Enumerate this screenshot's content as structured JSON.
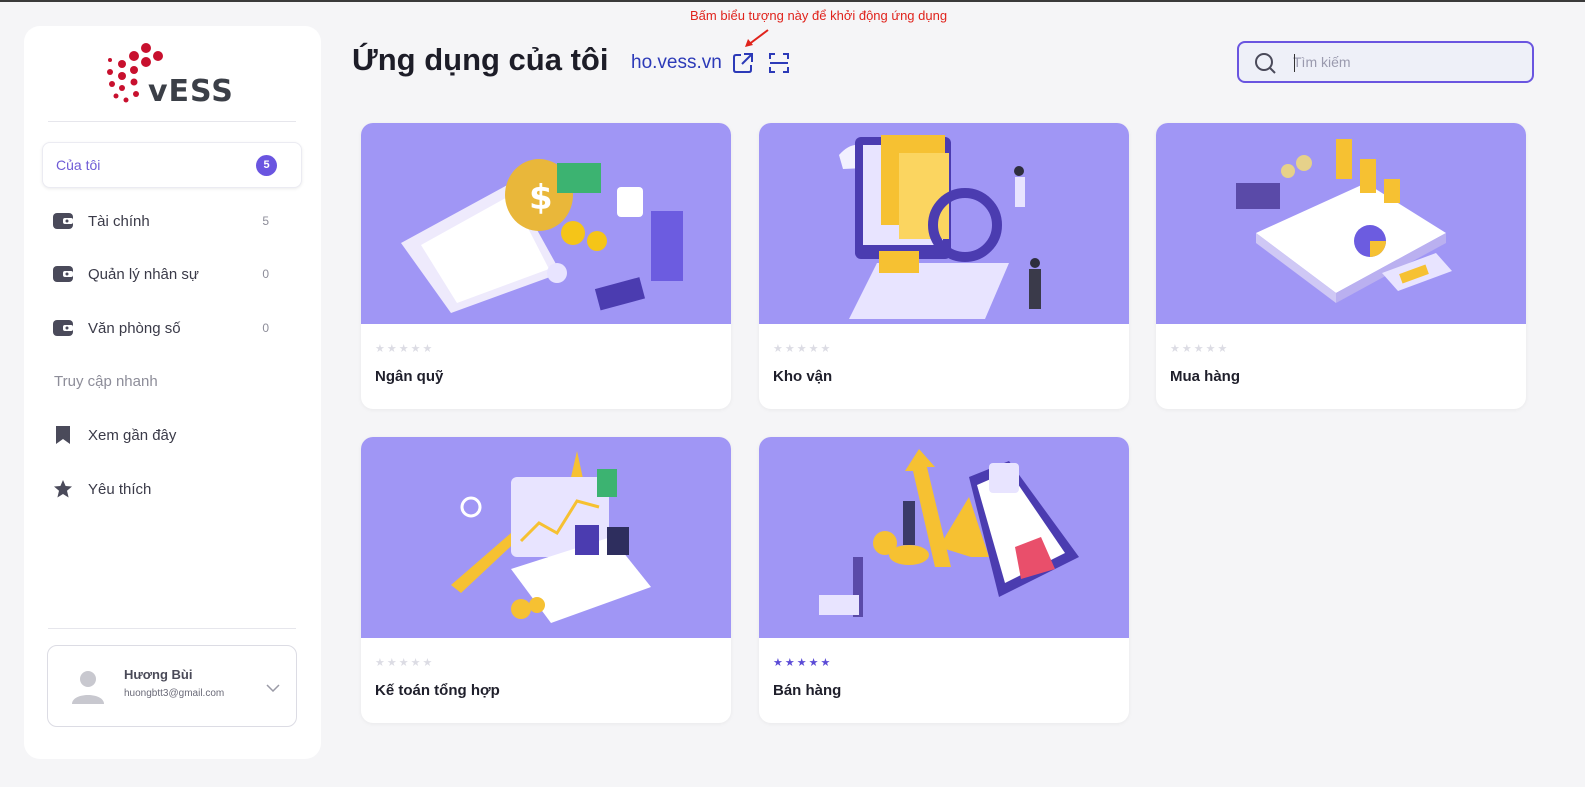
{
  "brand": {
    "logo_text": "vESS",
    "logo_color": "#c8102e"
  },
  "sidebar": {
    "items": [
      {
        "label": "Của tôi",
        "count": "5",
        "active": true
      },
      {
        "label": "Tài chính",
        "count": "5"
      },
      {
        "label": "Quản lý nhân sự",
        "count": "0"
      },
      {
        "label": "Văn phòng số",
        "count": "0"
      }
    ],
    "quick_access_title": "Truy cập nhanh",
    "quick_items": [
      {
        "label": "Xem gần đây",
        "icon": "bookmark-icon"
      },
      {
        "label": "Yêu thích",
        "icon": "star-icon"
      }
    ]
  },
  "user": {
    "name": "Hương Bùi",
    "email": "huongbtt3@gmail.com"
  },
  "header": {
    "title": "Ứng dụng của tôi",
    "domain": "ho.vess.vn",
    "annotation": "Bấm biểu tượng này để khởi động ứng dụng"
  },
  "search": {
    "placeholder": "Tìm kiếm",
    "value": ""
  },
  "apps": [
    {
      "name": "Ngân quỹ",
      "rating": 0,
      "stars": "★★★★★"
    },
    {
      "name": "Kho vận",
      "rating": 0,
      "stars": "★★★★★"
    },
    {
      "name": "Mua hàng",
      "rating": 0,
      "stars": "★★★★★"
    },
    {
      "name": "Kế toán tổng hợp",
      "rating": 0,
      "stars": "★★★★★"
    },
    {
      "name": "Bán hàng",
      "rating": 5,
      "stars": "★★★★★"
    }
  ],
  "colors": {
    "accent": "#6a55e0",
    "card_art": "#a096f5",
    "annotation": "#e0231c",
    "link": "#2c3ab8"
  }
}
